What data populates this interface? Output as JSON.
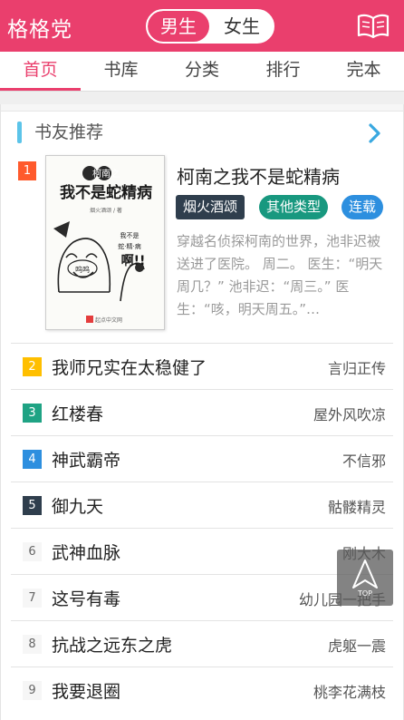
{
  "header": {
    "brand": "格格党",
    "gender_male": "男生",
    "gender_female": "女生",
    "bookshelf_icon": "open-book-icon",
    "color": "#ea3f6d"
  },
  "tabs": [
    {
      "label": "首页",
      "active": true
    },
    {
      "label": "书库",
      "active": false
    },
    {
      "label": "分类",
      "active": false
    },
    {
      "label": "排行",
      "active": false
    },
    {
      "label": "完本",
      "active": false
    }
  ],
  "section": {
    "title": "书友推荐",
    "more_icon": "chevron-right-icon"
  },
  "featured": {
    "rank": "1",
    "title": "柯南之我不是蛇精病",
    "author": "烟火酒颂",
    "category": "其他类型",
    "status": "连载",
    "description": "穿越名侦探柯南的世界，池非迟被送进了医院。 周二。 医生：“明天周几？” 池非迟：“周三。” 医生：“咳，明天周五。”…",
    "cover": {
      "top_text": "柯南之",
      "main_text": "我不是蛇精病",
      "author_line": "烟火酒颂 / 著",
      "speech1": "我不是",
      "speech2": "蛇·精·病",
      "shout": "啊!!",
      "bubble": "呜呜",
      "publisher": "起点中文网"
    }
  },
  "list": [
    {
      "rank": "2",
      "title": "我师兄实在太稳健了",
      "author": "言归正传",
      "badge_color": "#ffbf00"
    },
    {
      "rank": "3",
      "title": "红楼春",
      "author": "屋外风吹凉",
      "badge_color": "#1fa384"
    },
    {
      "rank": "4",
      "title": "神武霸帝",
      "author": "不信邪",
      "badge_color": "#2d8fdf"
    },
    {
      "rank": "5",
      "title": "御九天",
      "author": "骷髅精灵",
      "badge_color": "#2f3e4d"
    },
    {
      "rank": "6",
      "title": "武神血脉",
      "author": "刚大木",
      "badge_color": ""
    },
    {
      "rank": "7",
      "title": "这号有毒",
      "author": "幼儿园一把手",
      "badge_color": ""
    },
    {
      "rank": "8",
      "title": "抗战之远东之虎",
      "author": "虎躯一震",
      "badge_color": ""
    },
    {
      "rank": "9",
      "title": "我要退圈",
      "author": "桃李花满枝",
      "badge_color": ""
    }
  ],
  "top_button": {
    "label": "TOP",
    "icon": "arrow-up-icon"
  }
}
